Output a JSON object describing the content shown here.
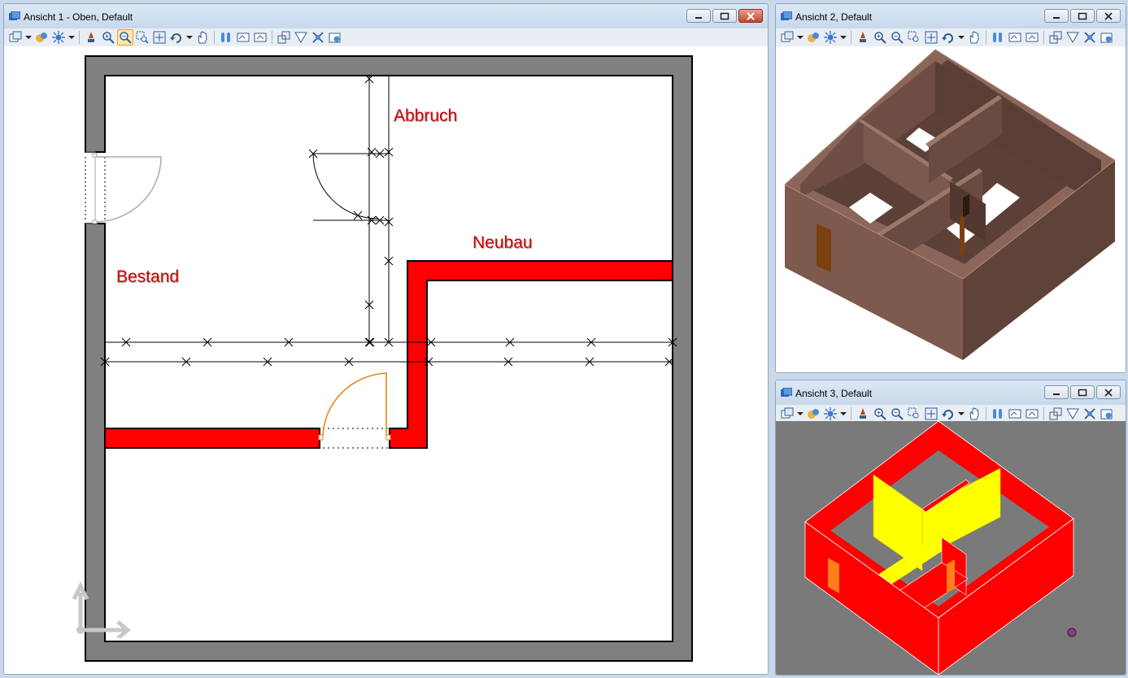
{
  "windows": [
    {
      "title": "Ansicht 1 - Oben, Default"
    },
    {
      "title": "Ansicht 2, Default"
    },
    {
      "title": "Ansicht 3, Default"
    }
  ],
  "plan_labels": {
    "abbruch": "Abbruch",
    "neubau": "Neubau",
    "bestand": "Bestand"
  },
  "colors": {
    "bestand_wall": "#808080",
    "neubau_wall": "#ff0000",
    "door_new": "#e8891d",
    "model_wall": "#6b4a3e",
    "model_door": "#7a4010",
    "abbruch_wall": "#ffff00"
  },
  "toolbar_icons": [
    "view-groups-icon",
    "display-style-icon",
    "lights-icon",
    "update-view-icon",
    "zoom-in-icon",
    "zoom-out-icon",
    "window-area-icon",
    "fit-view-icon",
    "rotate-view-icon",
    "pan-view-icon",
    "view-previous-icon",
    "view-next-icon",
    "copy-view-icon",
    "clip-volume-icon",
    "clip-mask-icon",
    "camera-icon",
    "view-attributes-icon"
  ]
}
